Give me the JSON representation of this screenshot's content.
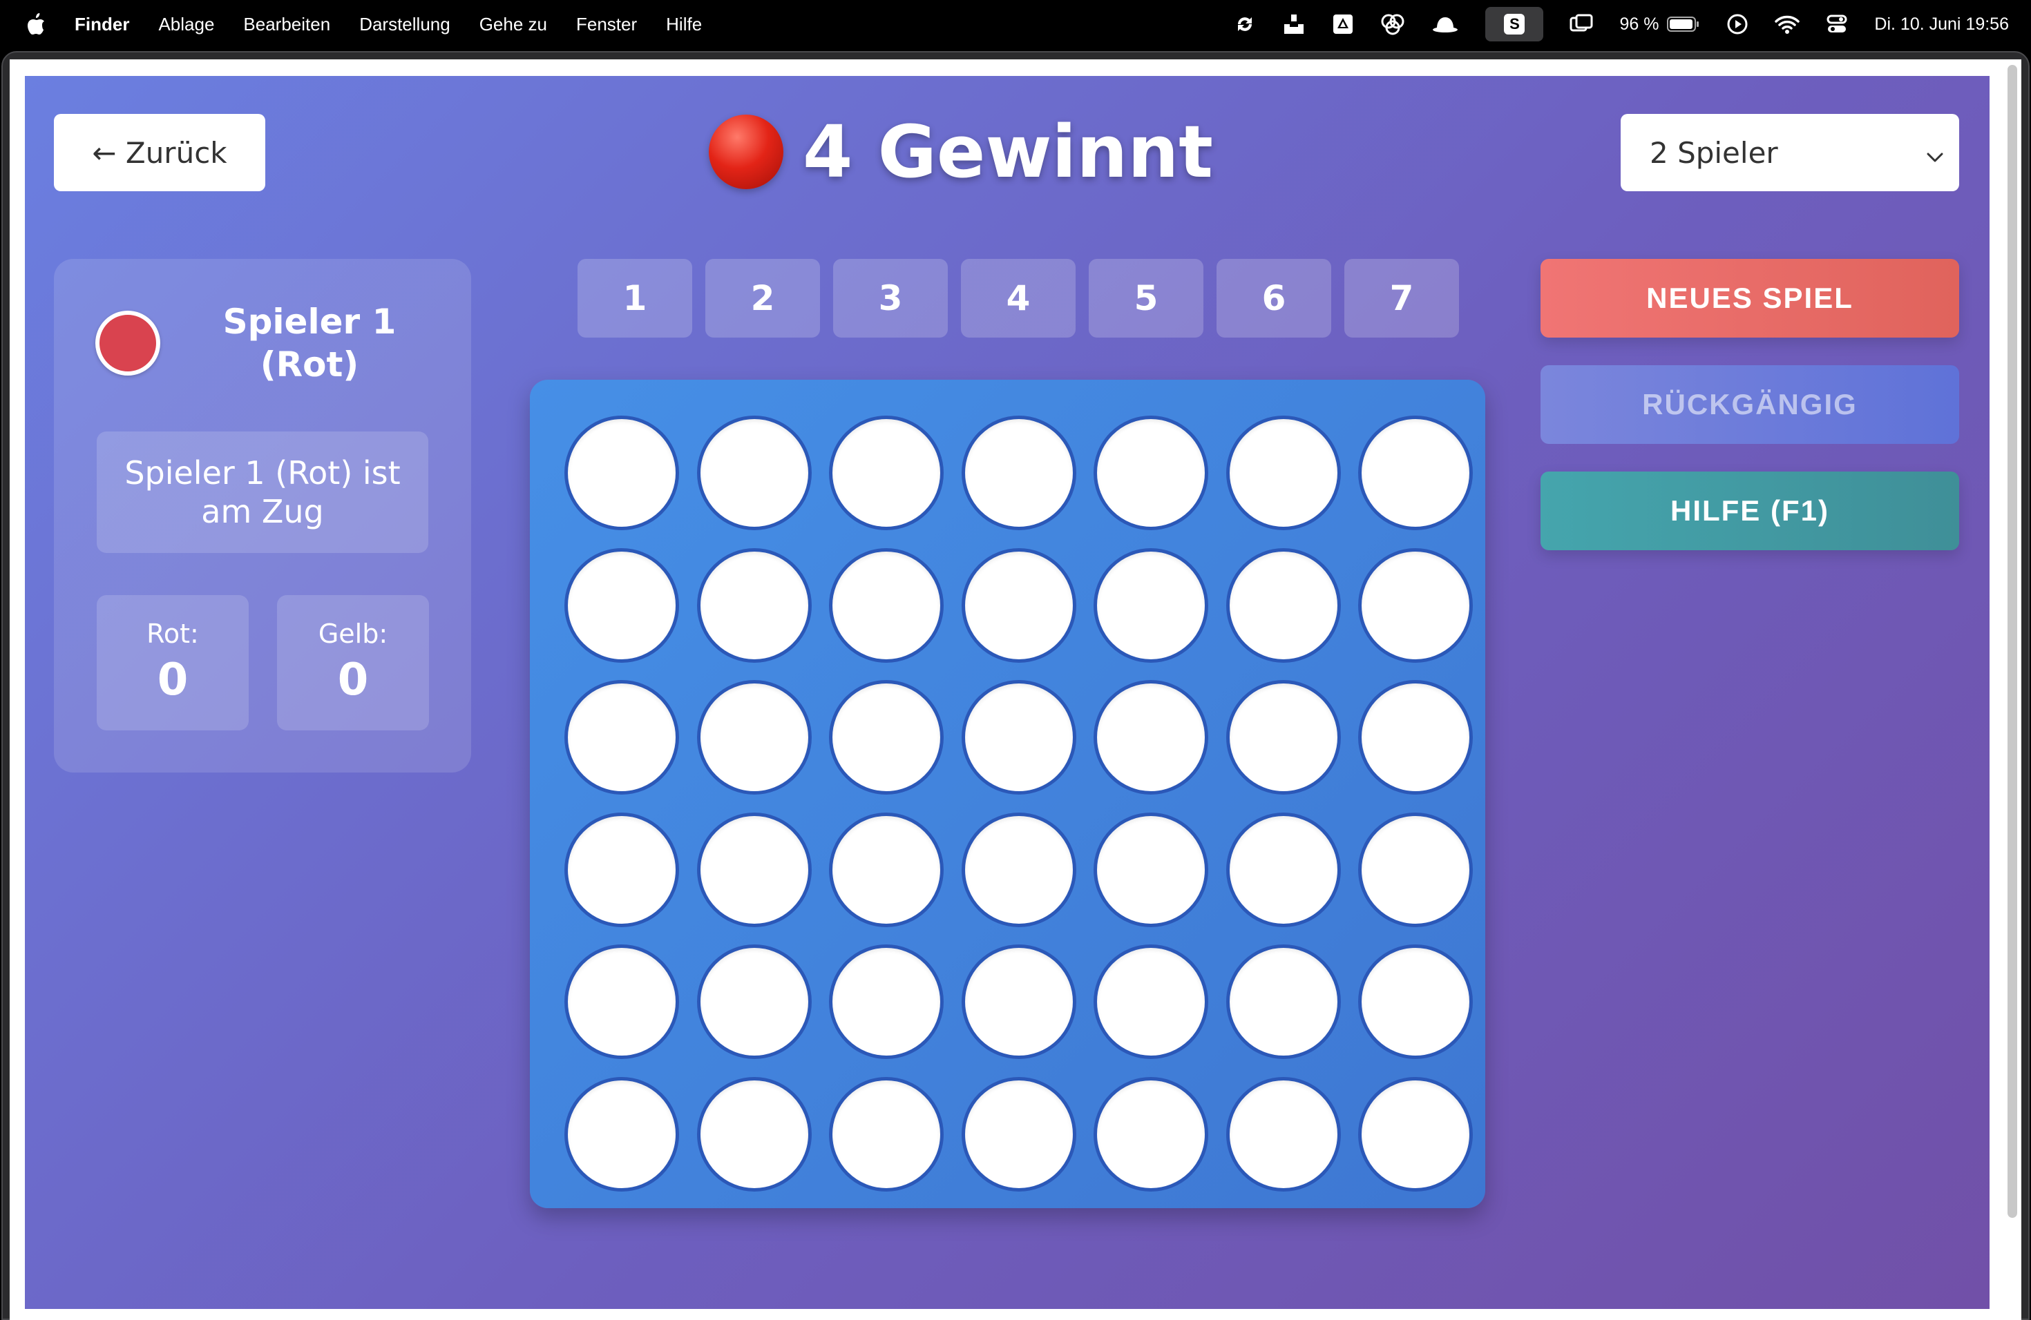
{
  "menubar": {
    "app_name": "Finder",
    "items": [
      "Ablage",
      "Bearbeiten",
      "Darstellung",
      "Gehe zu",
      "Fenster",
      "Hilfe"
    ],
    "battery": "96 %",
    "datetime": "Di. 10. Juni  19:56",
    "s_badge": "S"
  },
  "app": {
    "back_label": "← Zurück",
    "title": "4 Gewinnt",
    "mode_selected": "2 Spieler",
    "player_label_line1": "Spieler 1",
    "player_label_line2": "(Rot)",
    "status": "Spieler 1 (Rot) ist am Zug",
    "score_red_label": "Rot:",
    "score_red_value": "0",
    "score_yellow_label": "Gelb:",
    "score_yellow_value": "0",
    "column_labels": [
      "1",
      "2",
      "3",
      "4",
      "5",
      "6",
      "7"
    ],
    "new_game_label": "NEUES SPIEL",
    "undo_label": "RÜCKGÄNGIG",
    "help_label": "HILFE (F1)",
    "board": {
      "rows": 6,
      "cols": 7,
      "cells": "all-empty"
    }
  },
  "colors": {
    "player_red": "#d9434f",
    "board_blue": "#4286dc",
    "new_game": "#e96b68",
    "help": "#4299a2"
  }
}
